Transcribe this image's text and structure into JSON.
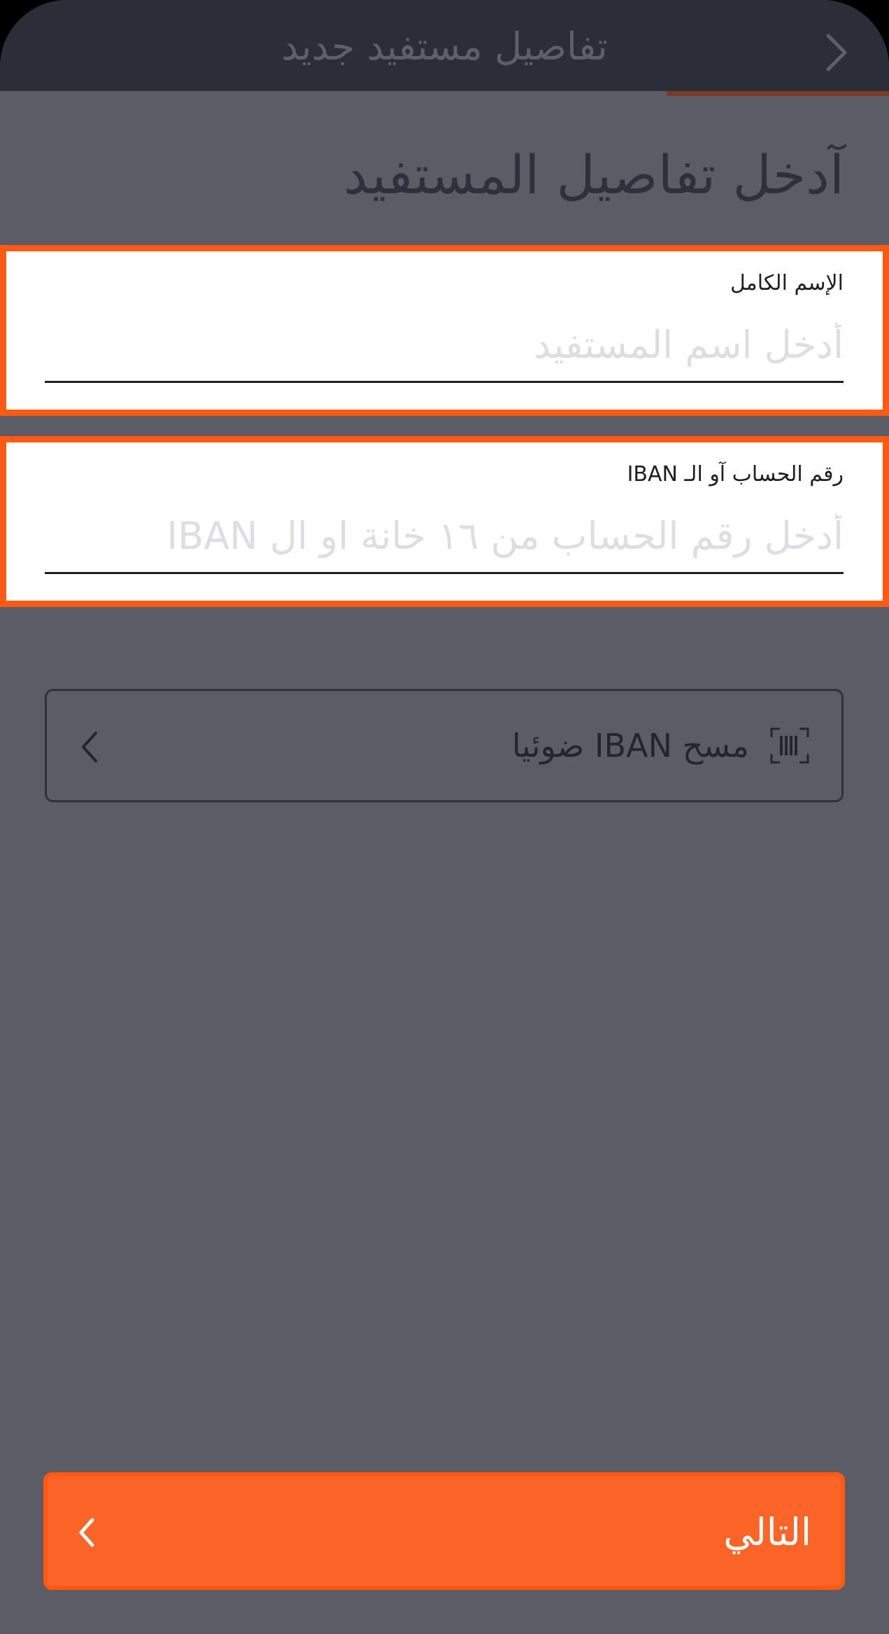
{
  "header": {
    "title": "تفاصيل مستفيد جديد"
  },
  "page": {
    "title": "آدخل تفاصيل المستفيد"
  },
  "form": {
    "full_name": {
      "label": "الإسم الكامل",
      "placeholder": "أدخل اسم المستفيد",
      "value": ""
    },
    "iban": {
      "label": "رقم الحساب آو الـ IBAN",
      "placeholder": "أدخل رقم الحساب من ١٦ خانة او ال IBAN",
      "value": ""
    }
  },
  "scan": {
    "label": "مسح IBAN ضوئيا",
    "icon": "barcode-scan-icon"
  },
  "next_button": {
    "label": "التالي"
  },
  "colors": {
    "background": "#5c5c67",
    "header": "#2b2d39",
    "accent": "#ff5a14",
    "button": "#fc6428",
    "field_background": "#ffffff"
  }
}
